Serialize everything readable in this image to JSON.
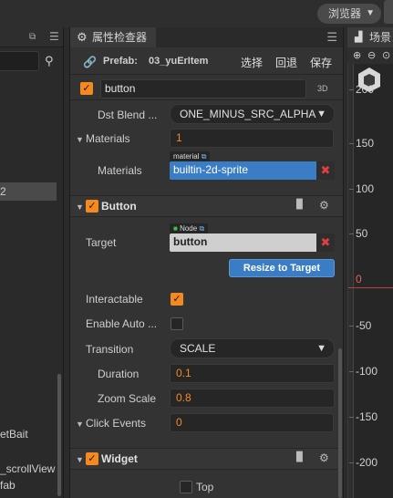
{
  "top": {
    "browser_label": "浏览器"
  },
  "left": {
    "items": [
      "2",
      "etBait",
      "_scrollView",
      "fab"
    ]
  },
  "inspector": {
    "tab_title": "属性检查器",
    "prefab": {
      "label": "Prefab:",
      "name": "03_yuErItem",
      "select": "选择",
      "revert": "回退",
      "save": "保存"
    },
    "node_name": "button",
    "label_3d": "3D",
    "dst_blend": {
      "label": "Dst Blend ...",
      "value": "ONE_MINUS_SRC_ALPHA"
    },
    "materials_group": {
      "label": "Materials",
      "count": "1"
    },
    "materials_item": {
      "label": "Materials",
      "tag": "material",
      "value": "builtin-2d-sprite"
    },
    "button_component": {
      "title": "Button"
    },
    "target": {
      "label": "Target",
      "tag": "Node",
      "value": "button"
    },
    "resize_label": "Resize to Target",
    "interactable": {
      "label": "Interactable",
      "checked": true
    },
    "enable_auto": {
      "label": "Enable Auto ...",
      "checked": false
    },
    "transition": {
      "label": "Transition",
      "value": "SCALE"
    },
    "duration": {
      "label": "Duration",
      "value": "0.1"
    },
    "zoom_scale": {
      "label": "Zoom Scale",
      "value": "0.8"
    },
    "click_events": {
      "label": "Click Events",
      "value": "0"
    },
    "widget_component": {
      "title": "Widget"
    },
    "widget_top": {
      "label": "Top",
      "checked": false
    }
  },
  "scene": {
    "tab_title": "场景",
    "ruler": [
      "200",
      "150",
      "100",
      "50",
      "0",
      "-50",
      "-100",
      "-150",
      "-200"
    ]
  },
  "colors": {
    "accent": "#f5891f",
    "selection": "#3a7dc4",
    "remove": "#e04040"
  }
}
